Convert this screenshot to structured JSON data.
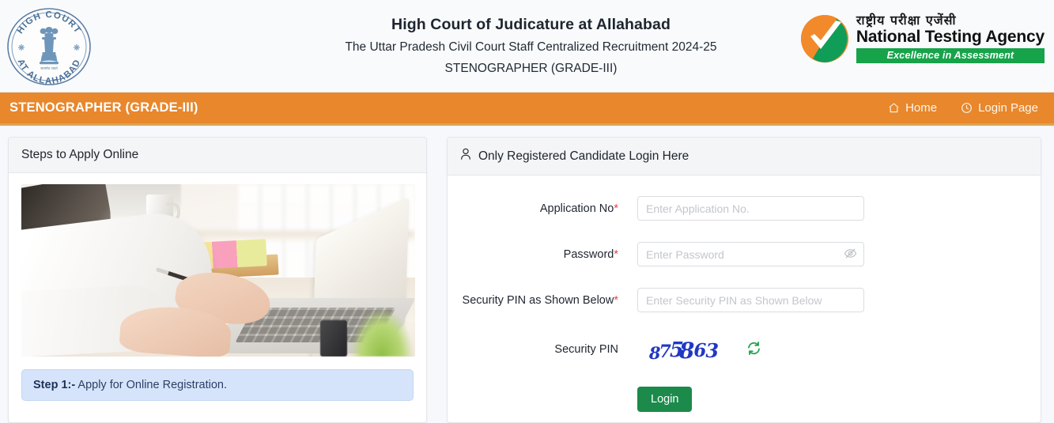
{
  "header": {
    "seal": {
      "top_text": "HIGH COURT",
      "bottom_text": "AT ALLAHABAD",
      "motto": "सत्यमेव जयते"
    },
    "title": "High Court of Judicature at Allahabad",
    "subtitle": "The Uttar Pradesh Civil Court Staff Centralized Recruitment 2024-25",
    "subtitle2": "STENOGRAPHER (GRADE-III)",
    "nta_logo": {
      "hindi": "राष्ट्रीय परीक्षा एजेंसी",
      "english": "National Testing Agency",
      "tagline": "Excellence in Assessment",
      "orange": "#f2892b",
      "green": "#17a34a"
    }
  },
  "navbar": {
    "brand": "STENOGRAPHER (GRADE-III)",
    "background": "#e8872b",
    "links": [
      {
        "label": "Home",
        "icon": "home-icon"
      },
      {
        "label": "Login Page",
        "icon": "clock-icon"
      }
    ]
  },
  "left_panel": {
    "heading": "Steps to Apply Online",
    "photo_alt": "person typing on laptop at desk",
    "steps": [
      {
        "number": "Step 1:-",
        "text": " Apply for Online Registration."
      }
    ]
  },
  "login_panel": {
    "heading": "Only Registered Candidate Login Here",
    "heading_icon": "user-icon",
    "fields": [
      {
        "label": "Application No",
        "required": "*",
        "placeholder": "Enter Application No.",
        "value": ""
      },
      {
        "label": "Password",
        "required": "*",
        "placeholder": "Enter Password",
        "value": "",
        "toggle_icon": "eye-slash-icon"
      },
      {
        "label": "Security PIN as Shown Below",
        "required": "*",
        "placeholder": "Enter Security PIN as Shown Below",
        "value": ""
      }
    ],
    "captcha": {
      "label": "Security PIN",
      "code": "875863",
      "digits": [
        "8",
        "7",
        "5",
        "8",
        "6",
        "3"
      ],
      "color": "#2138c4",
      "refresh_icon": "refresh-icon"
    },
    "submit": {
      "label": "Login",
      "color": "#1b8a4b"
    }
  }
}
